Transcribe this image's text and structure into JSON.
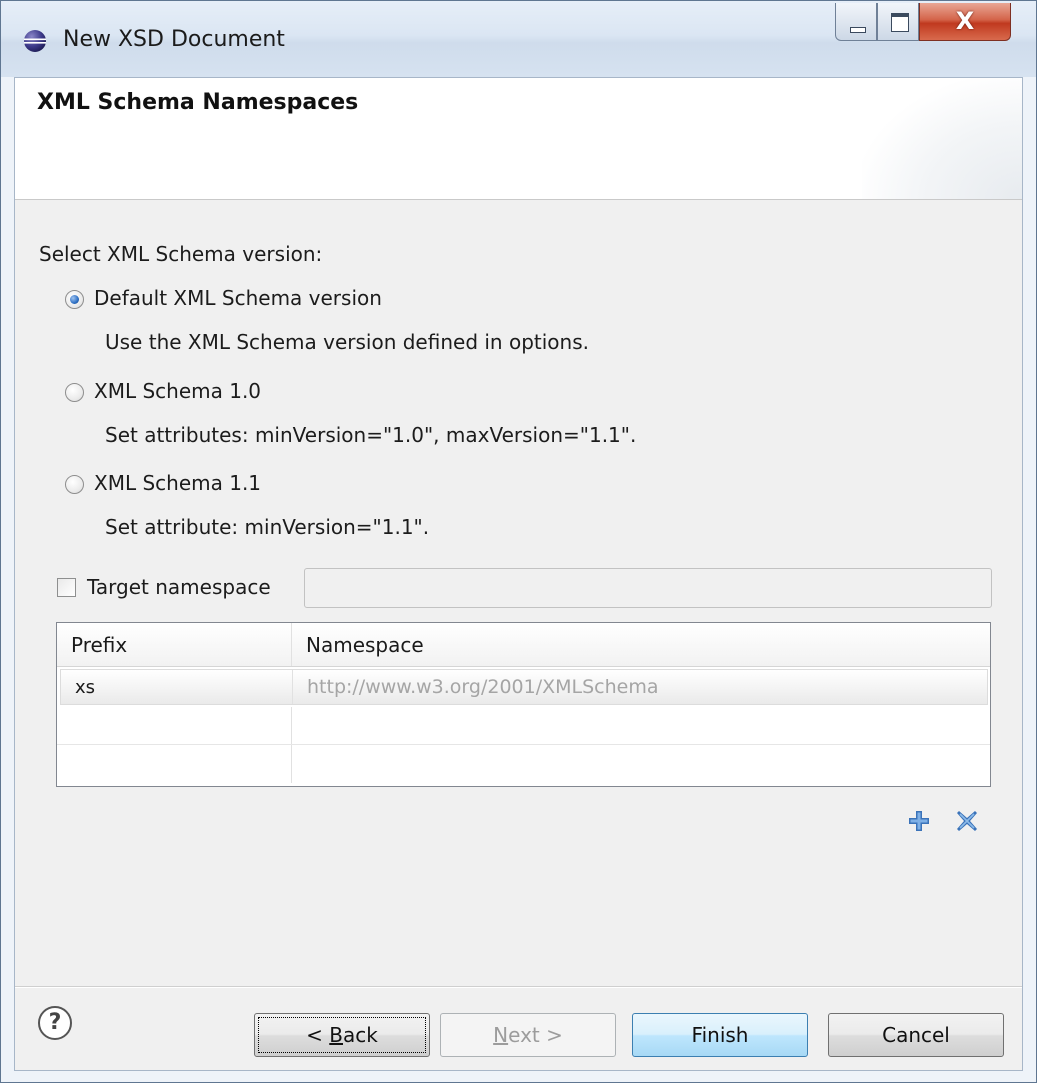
{
  "window": {
    "title": "New XSD Document",
    "close_glyph": "X"
  },
  "header": {
    "title": "XML Schema Namespaces"
  },
  "version": {
    "prompt": "Select XML Schema version:",
    "options": [
      {
        "label": "Default XML Schema version",
        "description": "Use the XML Schema version defined in options.",
        "selected": true
      },
      {
        "label": "XML Schema 1.0",
        "description": "Set attributes: minVersion=\"1.0\", maxVersion=\"1.1\".",
        "selected": false
      },
      {
        "label": "XML Schema 1.1",
        "description": "Set attribute: minVersion=\"1.1\".",
        "selected": false
      }
    ]
  },
  "target_namespace": {
    "label": "Target namespace",
    "checked": false,
    "value": ""
  },
  "table": {
    "columns": [
      "Prefix",
      "Namespace"
    ],
    "rows": [
      {
        "prefix": "xs",
        "namespace": "http://www.w3.org/2001/XMLSchema"
      },
      {
        "prefix": "",
        "namespace": ""
      },
      {
        "prefix": "",
        "namespace": ""
      }
    ]
  },
  "table_actions": {
    "add_icon": "add-icon",
    "remove_icon": "remove-icon"
  },
  "footer": {
    "help_glyph": "?",
    "back_prefix": "< ",
    "back_mnemonic": "B",
    "back_rest": "ack",
    "next_mnemonic": "N",
    "next_rest": "ext >",
    "finish_label": "Finish",
    "cancel_label": "Cancel"
  },
  "colors": {
    "accent": "#3b73b9",
    "disabled_text": "#9c9c9c",
    "namespace_text": "#a5a5a5"
  }
}
